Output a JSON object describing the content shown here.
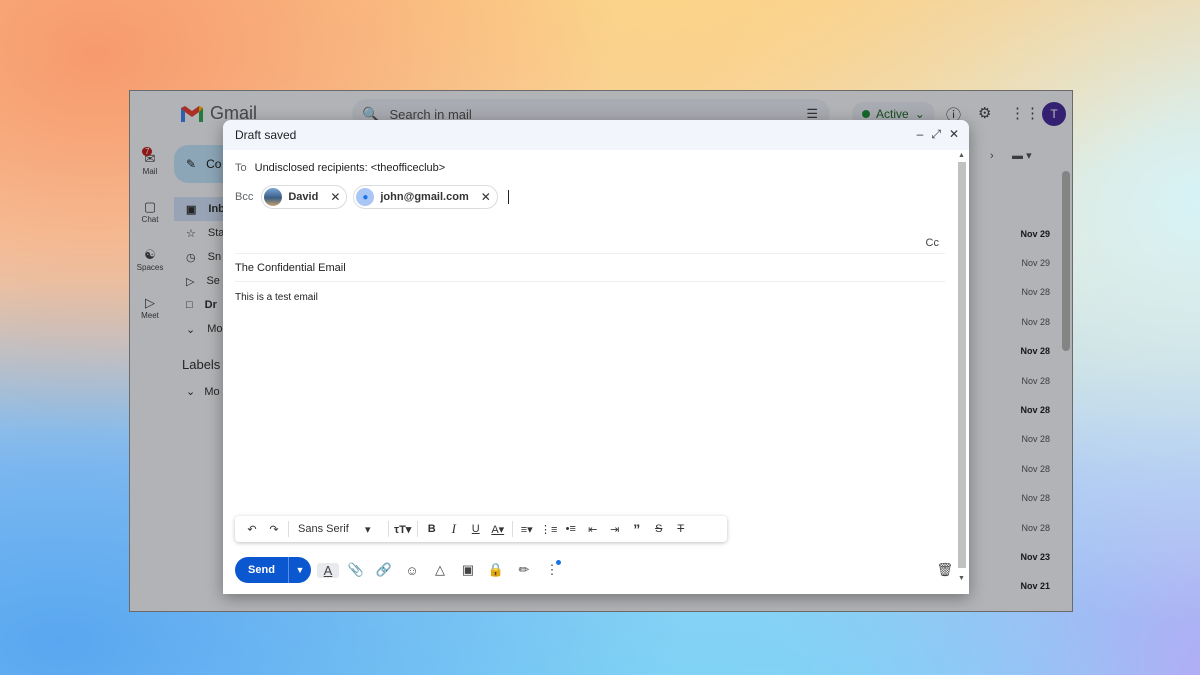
{
  "gmail": {
    "logo_text": "Gmail",
    "search_placeholder": "Search in mail",
    "status": "Active",
    "avatar_letter": "T",
    "rail": [
      {
        "label": "Mail",
        "icon": "mail-icon",
        "badge": "7"
      },
      {
        "label": "Chat",
        "icon": "chat-icon"
      },
      {
        "label": "Spaces",
        "icon": "spaces-icon"
      },
      {
        "label": "Meet",
        "icon": "meet-icon"
      }
    ],
    "compose_label": "Co",
    "nav": [
      "Inb",
      "Sta",
      "Sn",
      "Se",
      "Dr",
      "Mo"
    ],
    "labels_heading": "Labels",
    "labels_more": "Mo",
    "dates": [
      {
        "text": "Nov 29",
        "bold": true
      },
      {
        "text": "Nov 29",
        "bold": false
      },
      {
        "text": "Nov 28",
        "bold": false
      },
      {
        "text": "Nov 28",
        "bold": false
      },
      {
        "text": "Nov 28",
        "bold": true
      },
      {
        "text": "Nov 28",
        "bold": false
      },
      {
        "text": "Nov 28",
        "bold": true
      },
      {
        "text": "Nov 28",
        "bold": false
      },
      {
        "text": "Nov 28",
        "bold": false
      },
      {
        "text": "Nov 28",
        "bold": false
      },
      {
        "text": "Nov 28",
        "bold": false
      },
      {
        "text": "Nov 23",
        "bold": true
      },
      {
        "text": "Nov 21",
        "bold": true
      }
    ]
  },
  "compose": {
    "title": "Draft saved",
    "to_label": "To",
    "to_value": "Undisclosed recipients: <theofficeclub>",
    "bcc_label": "Bcc",
    "bcc_chips": [
      {
        "name": "David",
        "avatar": "photo"
      },
      {
        "name": "john@gmail.com",
        "avatar": "person-icon"
      }
    ],
    "cc_label": "Cc",
    "subject": "The Confidential Email",
    "body": "This is a test email",
    "font_name": "Sans Serif",
    "send_label": "Send"
  }
}
